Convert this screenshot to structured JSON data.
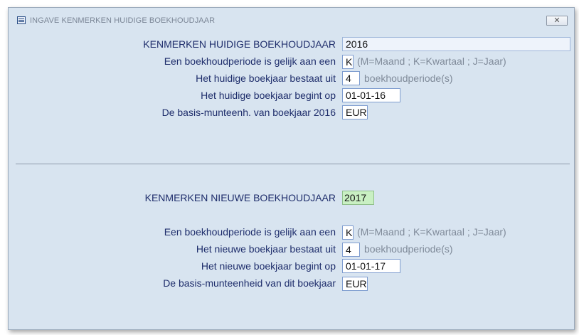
{
  "window": {
    "title": "INGAVE KENMERKEN HUIDIGE BOEKHOUDJAAR",
    "close_label": "✕"
  },
  "current": {
    "heading": "KENMERKEN HUIDIGE BOEKHOUDJAAR",
    "year_value": "2016",
    "period_label": "Een boekhoudperiode is gelijk aan een",
    "period_value": "K",
    "period_hint": "(M=Maand ; K=Kwartaal ; J=Jaar)",
    "count_label": "Het huidige boekjaar bestaat uit",
    "count_value": "4",
    "count_hint": "boekhoudperiode(s)",
    "start_label": "Het huidige boekjaar begint op",
    "start_value": "01-01-16",
    "currency_label": "De basis-munteenh. van boekjaar 2016",
    "currency_value": "EUR"
  },
  "next": {
    "heading": "KENMERKEN NIEUWE BOEKHOUDJAAR",
    "year_value": "2017",
    "period_label": "Een boekhoudperiode is gelijk aan een",
    "period_value": "K",
    "period_hint": "(M=Maand ; K=Kwartaal ; J=Jaar)",
    "count_label": "Het nieuwe boekjaar bestaat uit",
    "count_value": "4",
    "count_hint": "boekhoudperiode(s)",
    "start_label": "Het nieuwe boekjaar begint op",
    "start_value": "01-01-17",
    "currency_label": "De basis-munteenheid van dit boekjaar",
    "currency_value": "EUR"
  },
  "icons": {
    "window_icon": "form-icon",
    "close_icon": "close-icon"
  },
  "colors": {
    "background": "#d8e4f0",
    "label_text": "#1e2d6b",
    "hint_text": "#7f8a99",
    "highlight_field": "#c9f0c3"
  }
}
